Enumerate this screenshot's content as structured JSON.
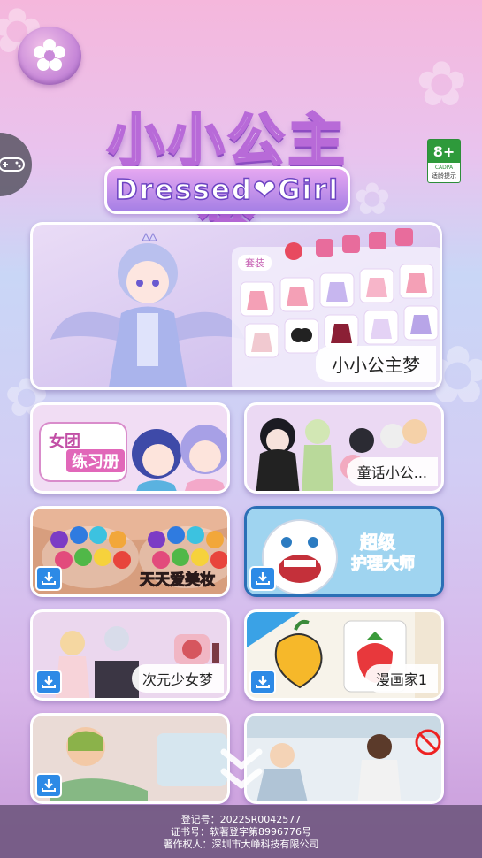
{
  "logo": {
    "title_cn": "小小公主梦",
    "title_en": "Dressed❤Girl"
  },
  "rating": {
    "age": "8+",
    "org": "CADPA",
    "tip": "适龄提示"
  },
  "featured": {
    "label": "小小公主梦",
    "suit_tag": "套装"
  },
  "games": [
    {
      "label": "女团练习册",
      "download": false
    },
    {
      "label": "童话小公...",
      "download": false
    },
    {
      "label": "天天爱美妆",
      "download": true
    },
    {
      "label": "超级护理大师",
      "download": true
    },
    {
      "label": "次元少女梦",
      "download": true
    },
    {
      "label": "漫画家1",
      "download": true
    },
    {
      "label": "",
      "download": true
    },
    {
      "label": "",
      "download": false
    }
  ],
  "card_texts": {
    "group_title_1": "女团",
    "group_title_2": "练习册",
    "nurse_title_1": "超级",
    "nurse_title_2": "护理大师"
  },
  "footer": {
    "line1": "登记号：2022SR0042577",
    "line2": "证书号：软著登字第8996776号",
    "line3": "著作权人：深圳市大峥科技有限公司"
  },
  "colors": {
    "accent_purple": "#b86ad8",
    "download_blue": "#2d8ae6",
    "rating_green": "#2e9a3b"
  }
}
